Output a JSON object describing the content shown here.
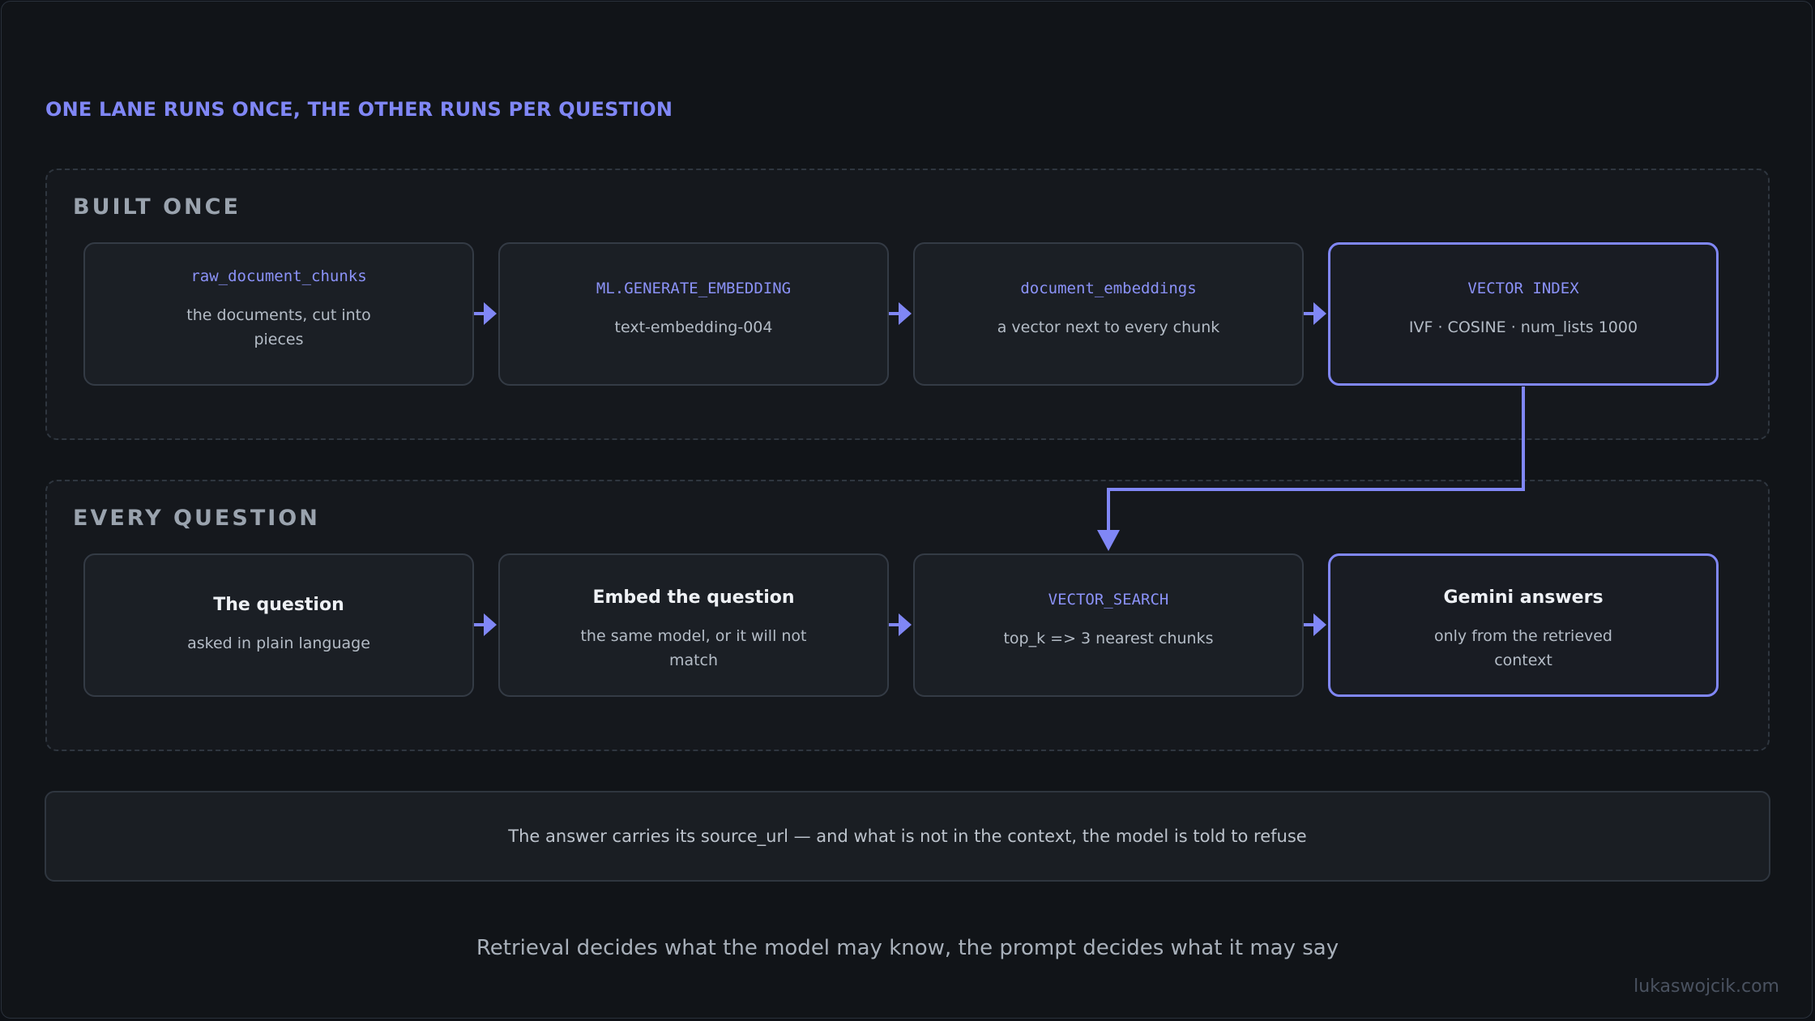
{
  "headline": "ONE LANE RUNS ONCE, THE OTHER RUNS PER QUESTION",
  "lanes": {
    "built_once": {
      "label": "BUILT ONCE",
      "nodes": [
        {
          "mono": "raw_document_chunks",
          "sub": "the documents, cut into pieces"
        },
        {
          "mono": "ML.GENERATE_EMBEDDING",
          "sub": "text-embedding-004"
        },
        {
          "mono": "document_embeddings",
          "sub": "a vector next to every chunk"
        },
        {
          "mono": "VECTOR INDEX",
          "sub": "IVF · COSINE · num_lists 1000"
        }
      ]
    },
    "every_question": {
      "label": "EVERY QUESTION",
      "nodes": [
        {
          "title": "The question",
          "sub": "asked in plain language"
        },
        {
          "title": "Embed the question",
          "sub": "the same model, or it will not match"
        },
        {
          "mono": "VECTOR_SEARCH",
          "sub": "top_k => 3 nearest chunks"
        },
        {
          "title": "Gemini answers",
          "sub": "only from the retrieved context"
        }
      ]
    }
  },
  "note": "The answer carries its source_url — and what is not in the context, the model is told to refuse",
  "footer": "Retrieval decides what the model may know, the prompt decides what it may say",
  "credit": "lukaswojcik.com",
  "colors": {
    "accent": "#8087f6",
    "background": "#111418",
    "node_border": "#343b45"
  }
}
